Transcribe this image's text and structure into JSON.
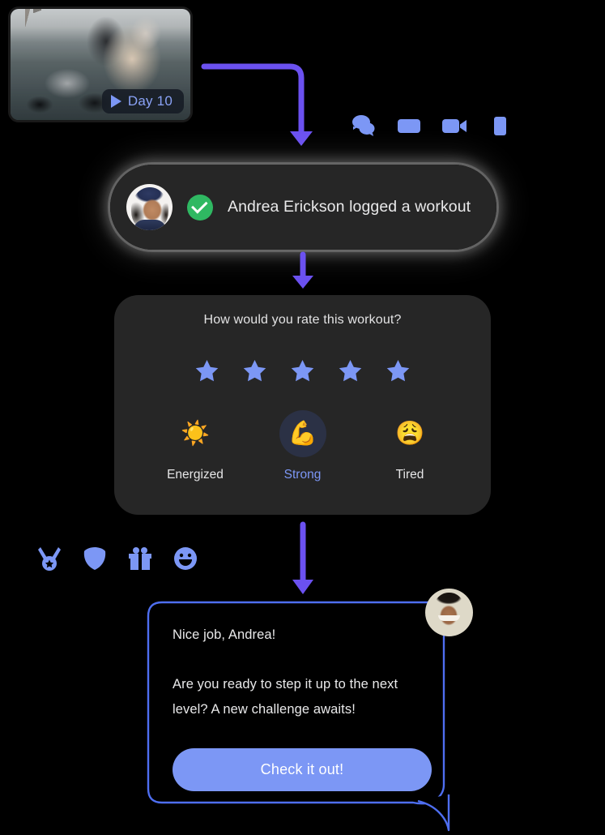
{
  "video_card": {
    "name": "workout-video-thumbnail",
    "badge_label": "Day 10",
    "play_icon": "play-icon"
  },
  "decor_icons_top": [
    {
      "name": "chat-bubbles-icon",
      "label": "chat bubbles"
    },
    {
      "name": "message-card-icon",
      "label": "message card"
    },
    {
      "name": "video-camera-icon",
      "label": "video camera"
    },
    {
      "name": "phone-icon",
      "label": "phone"
    }
  ],
  "decor_icons_bottom": [
    {
      "name": "medal-icon",
      "label": "medal"
    },
    {
      "name": "badge-icon",
      "label": "badge"
    },
    {
      "name": "gift-icon",
      "label": "gift"
    },
    {
      "name": "smiley-icon",
      "label": "smiley"
    }
  ],
  "notification": {
    "avatar_name": "andrea-avatar",
    "status_icon": "check-circle-icon",
    "message": "Andrea Erickson logged a workout"
  },
  "rating_card": {
    "title": "How would you rate this workout?",
    "stars": {
      "total": 5,
      "filled": 5
    },
    "moods": [
      {
        "id": "energized",
        "emoji": "☀️",
        "label": "Energized",
        "selected": false
      },
      {
        "id": "strong",
        "emoji": "💪",
        "label": "Strong",
        "selected": true
      },
      {
        "id": "tired",
        "emoji": "😩",
        "label": "Tired",
        "selected": false
      }
    ]
  },
  "chat_bubble": {
    "avatar_name": "coach-avatar",
    "line1": "Nice job, Andrea!",
    "line2": "Are you ready to step it up to the next",
    "line3": "level? A new challenge awaits!",
    "cta_label": "Check it out!"
  },
  "colors": {
    "background": "#000000",
    "card": "#262626",
    "accent_blue": "#7c97f5",
    "arrow_purple": "#6b51f0",
    "success_green": "#2fb862",
    "mood_selected_bg": "#2b3145",
    "text_primary": "#e9e9ea"
  }
}
